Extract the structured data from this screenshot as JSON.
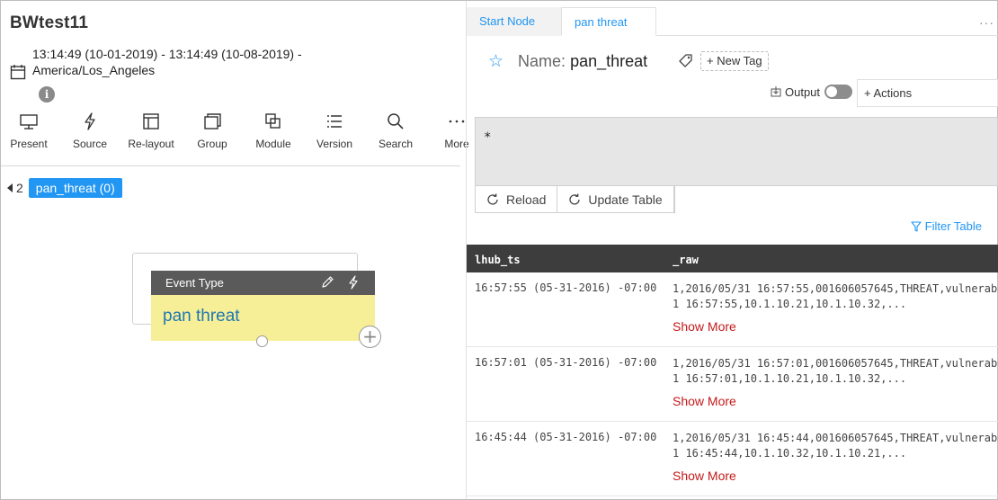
{
  "workspace": {
    "title": "BWtest11",
    "date_range_line1": "13:14:49 (10-01-2019) - 13:14:49 (10-08-2019) -",
    "date_range_line2": "America/Los_Angeles",
    "info_glyph": "i"
  },
  "toolbar": {
    "items": [
      {
        "label": "Present",
        "icon": "monitor-icon"
      },
      {
        "label": "Source",
        "icon": "lightning-icon"
      },
      {
        "label": "Re-layout",
        "icon": "layout-icon"
      },
      {
        "label": "Group",
        "icon": "group-icon"
      },
      {
        "label": "Module",
        "icon": "module-icon"
      },
      {
        "label": "Version",
        "icon": "list-icon"
      },
      {
        "label": "Search",
        "icon": "search-icon"
      },
      {
        "label": "More",
        "icon": "more-icon"
      }
    ]
  },
  "breadcrumb": {
    "back_label": "2",
    "current_label": "pan_threat (0)"
  },
  "canvas_node": {
    "header": "Event Type",
    "body": "pan threat",
    "add_glyph": "+"
  },
  "right_panel": {
    "tabs": [
      {
        "label": "Start Node",
        "active": false
      },
      {
        "label": "pan threat",
        "active": true
      }
    ],
    "more_glyph": "···",
    "name_label": "Name:",
    "name_value": "pan_threat",
    "new_tag": "+ New Tag",
    "output_label": "Output",
    "output_enabled": false,
    "actions_label": "+ Actions",
    "query_text": "*",
    "reload_label": "Reload",
    "update_table_label": "Update Table",
    "filter_table_label": "Filter Table"
  },
  "table": {
    "columns": [
      "lhub_ts",
      "_raw"
    ],
    "show_more_label": "Show More",
    "rows": [
      {
        "ts": "16:57:55 (05-31-2016) -07:00",
        "raw_line1": "1,2016/05/31 16:57:55,001606057645,THREAT,vulnerab",
        "raw_line2": "1 16:57:55,10.1.10.21,10.1.10.32,..."
      },
      {
        "ts": "16:57:01 (05-31-2016) -07:00",
        "raw_line1": "1,2016/05/31 16:57:01,001606057645,THREAT,vulnerab",
        "raw_line2": "1 16:57:01,10.1.10.21,10.1.10.32,..."
      },
      {
        "ts": "16:45:44 (05-31-2016) -07:00",
        "raw_line1": "1,2016/05/31 16:45:44,001606057645,THREAT,vulnerab",
        "raw_line2": "1 16:45:44,10.1.10.32,10.1.10.21,..."
      }
    ]
  },
  "colors": {
    "accent": "#2196f3",
    "show_more": "#c41a1a",
    "node_header": "#5a5a5a",
    "node_body": "#f6ef97",
    "table_header": "#3d3d3d"
  }
}
